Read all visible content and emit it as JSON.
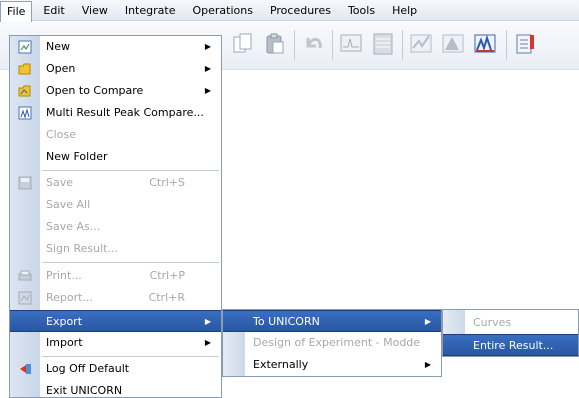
{
  "menubar": {
    "items": [
      "File",
      "Edit",
      "View",
      "Integrate",
      "Operations",
      "Procedures",
      "Tools",
      "Help"
    ]
  },
  "file_menu": {
    "items": [
      {
        "label": "New",
        "submenu": true,
        "icon": "new-chromatogram-icon",
        "enabled": true
      },
      {
        "label": "Open",
        "submenu": true,
        "icon": "open-folder-icon",
        "enabled": true
      },
      {
        "label": "Open to Compare",
        "submenu": true,
        "icon": "open-compare-folder-icon",
        "enabled": true
      },
      {
        "label": "Multi Result Peak Compare...",
        "icon": "peak-compare-icon",
        "enabled": true
      },
      {
        "label": "Close",
        "enabled": false
      },
      {
        "label": "New Folder",
        "enabled": true
      },
      {
        "label": "Save",
        "shortcut": "Ctrl+S",
        "icon": "save-icon",
        "enabled": false
      },
      {
        "label": "Save All",
        "enabled": false
      },
      {
        "label": "Save As...",
        "enabled": false
      },
      {
        "label": "Sign Result...",
        "enabled": false
      },
      {
        "label": "Print...",
        "shortcut": "Ctrl+P",
        "icon": "print-icon",
        "enabled": false
      },
      {
        "label": "Report...",
        "shortcut": "Ctrl+R",
        "icon": "report-icon",
        "enabled": false
      },
      {
        "label": "Export",
        "submenu": true,
        "enabled": true,
        "highlighted": true
      },
      {
        "label": "Import",
        "submenu": true,
        "enabled": true
      },
      {
        "label": "Log Off Default",
        "icon": "log-off-icon",
        "enabled": true
      },
      {
        "label": "Exit UNICORN",
        "enabled": true
      }
    ]
  },
  "export_submenu": {
    "items": [
      {
        "label": "To UNICORN",
        "submenu": true,
        "highlighted": true
      },
      {
        "label": "Design of Experiment - Modde",
        "enabled": false
      },
      {
        "label": "Externally",
        "submenu": true
      }
    ]
  },
  "unicorn_submenu": {
    "items": [
      {
        "label": "Curves",
        "enabled": false
      },
      {
        "label": "Entire Result...",
        "enabled": true,
        "highlighted": true
      }
    ]
  },
  "colors": {
    "highlight": "#2856a3",
    "gutter": "#c8d6e8",
    "disabled_text": "#a8a8a8"
  }
}
